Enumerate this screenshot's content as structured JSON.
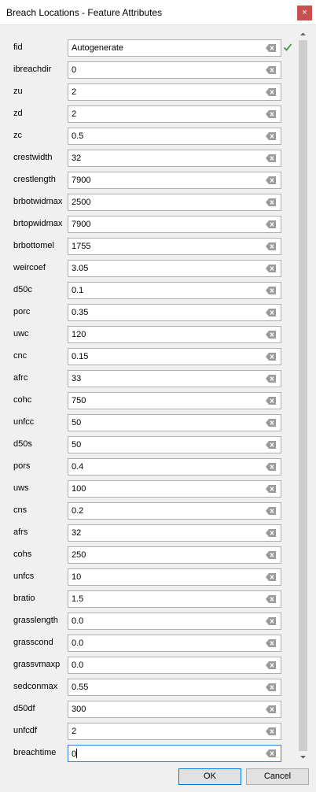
{
  "window": {
    "title": "Breach Locations - Feature Attributes",
    "close_label": "×"
  },
  "fields": [
    {
      "label": "fid",
      "value": "Autogenerate"
    },
    {
      "label": "ibreachdir",
      "value": "0"
    },
    {
      "label": "zu",
      "value": "2"
    },
    {
      "label": "zd",
      "value": "2"
    },
    {
      "label": "zc",
      "value": "0.5"
    },
    {
      "label": "crestwidth",
      "value": "32"
    },
    {
      "label": "crestlength",
      "value": "7900"
    },
    {
      "label": "brbotwidmax",
      "value": "2500"
    },
    {
      "label": "brtopwidmax",
      "value": "7900"
    },
    {
      "label": "brbottomel",
      "value": "1755"
    },
    {
      "label": "weircoef",
      "value": "3.05"
    },
    {
      "label": "d50c",
      "value": "0.1"
    },
    {
      "label": "porc",
      "value": "0.35"
    },
    {
      "label": "uwc",
      "value": "120"
    },
    {
      "label": "cnc",
      "value": "0.15"
    },
    {
      "label": "afrc",
      "value": "33"
    },
    {
      "label": "cohc",
      "value": "750"
    },
    {
      "label": "unfcc",
      "value": "50"
    },
    {
      "label": "d50s",
      "value": "50"
    },
    {
      "label": "pors",
      "value": "0.4"
    },
    {
      "label": "uws",
      "value": "100"
    },
    {
      "label": "cns",
      "value": "0.2"
    },
    {
      "label": "afrs",
      "value": "32"
    },
    {
      "label": "cohs",
      "value": "250"
    },
    {
      "label": "unfcs",
      "value": "10"
    },
    {
      "label": "bratio",
      "value": "1.5"
    },
    {
      "label": "grasslength",
      "value": "0.0"
    },
    {
      "label": "grasscond",
      "value": "0.0"
    },
    {
      "label": "grassvmaxp",
      "value": "0.0"
    },
    {
      "label": "sedconmax",
      "value": "0.55"
    },
    {
      "label": "d50df",
      "value": "300"
    },
    {
      "label": "unfcdf",
      "value": "2"
    },
    {
      "label": "breachtime",
      "value": "0"
    }
  ],
  "buttons": {
    "ok": "OK",
    "cancel": "Cancel"
  },
  "colors": {
    "close_bg": "#c75050",
    "check_green": "#3c9a3c",
    "focus_border": "#3b7ddd"
  },
  "icons": {
    "clear": "clear-field-icon",
    "valid": "checkmark-icon"
  }
}
